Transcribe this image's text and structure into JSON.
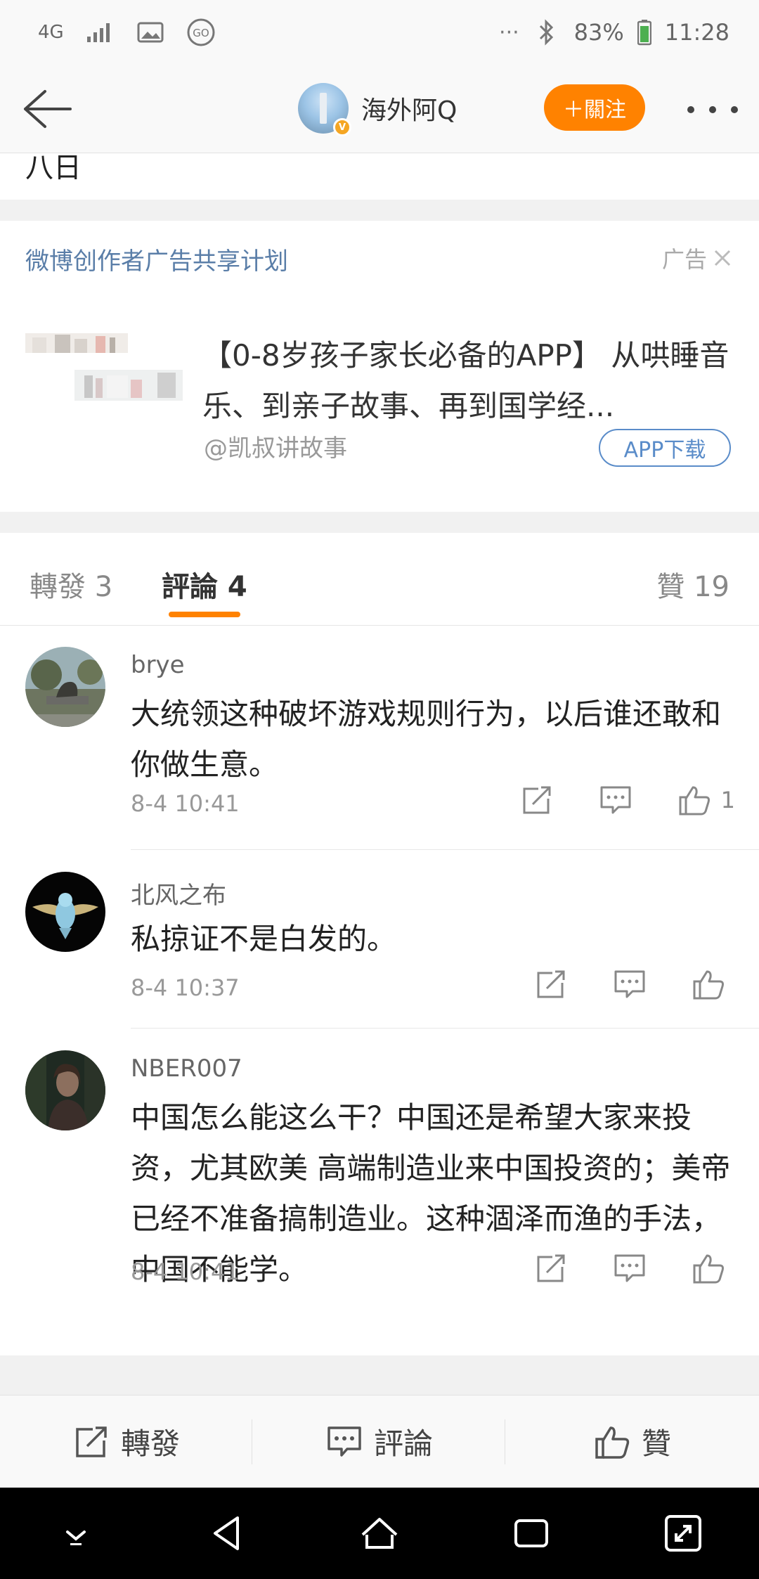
{
  "status_bar": {
    "network": "4G",
    "battery": "83%",
    "time": "11:28",
    "icons": [
      "network-4g-icon",
      "signal-icon",
      "gallery-icon",
      "go-icon",
      "more-dots-icon",
      "bluetooth-icon",
      "battery-icon"
    ]
  },
  "header": {
    "title": "海外阿Q",
    "follow_label": "＋關注",
    "verified_badge": "V"
  },
  "post_tail": {
    "text": "八日"
  },
  "ad": {
    "program_label": "微博创作者广告共享计划",
    "tag": "广告",
    "title": "【0-8岁孩子家长必备的APP】 从哄睡音乐、到亲子故事、再到国学经...",
    "source": "@凯叔讲故事",
    "button": "APP下载"
  },
  "tabs": {
    "repost": "轉發 3",
    "comment": "評論 4",
    "like": "贊 19",
    "active": "comment"
  },
  "comments": [
    {
      "name": "brye",
      "text": "大统领这种破坏游戏规则行为，以后谁还敢和你做生意。",
      "time": "8-4 10:41",
      "likes": "1"
    },
    {
      "name": "北风之布",
      "text": "私掠证不是白发的。",
      "time": "8-4 10:37",
      "likes": ""
    },
    {
      "name": "NBER007",
      "text": "中国怎么能这么干？中国还是希望大家来投资，尤其欧美 高端制造业来中国投资的；美帝已经不准备搞制造业。这种涸泽而渔的手法，中国不能学。",
      "time": "8-4 10:41",
      "likes": ""
    }
  ],
  "bottom_bar": {
    "repost": "轉發",
    "comment": "評論",
    "like": "贊"
  },
  "colors": {
    "accent": "#ff8200",
    "link": "#5a7ea8",
    "button_outline": "#5a8cc9"
  }
}
